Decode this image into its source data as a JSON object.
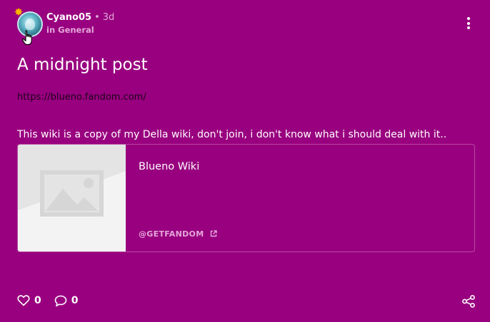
{
  "post": {
    "author": "Cyano05",
    "separator": "•",
    "time": "3d",
    "category": "in General",
    "title": "A midnight post",
    "link": "https://blueno.fandom.com/",
    "body": "This wiki is a copy of my Della wiki, don't join, i don't know what i should deal with it..",
    "card": {
      "title": "Blueno Wiki",
      "source": "@GETFANDOM"
    },
    "likes": "0",
    "replies": "0"
  },
  "icons": {
    "badge": "star-badge-icon",
    "more": "kebab-menu-icon",
    "like": "heart-icon",
    "reply": "speech-bubble-icon",
    "share": "share-icon",
    "external": "external-link-icon",
    "placeholder": "image-placeholder-icon"
  },
  "colors": {
    "background": "#99007f",
    "text": "#ffffff",
    "muted": "#e3a7d9",
    "link_text": "#1a001a",
    "card_border": "#b84aa3",
    "badge": "#ffb400"
  }
}
